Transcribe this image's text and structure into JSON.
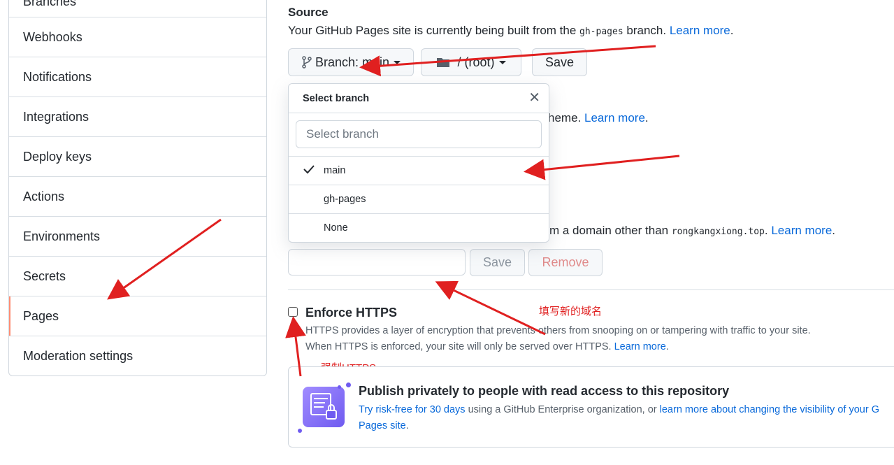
{
  "sidebar": {
    "items": [
      {
        "label": "Branches"
      },
      {
        "label": "Webhooks"
      },
      {
        "label": "Notifications"
      },
      {
        "label": "Integrations"
      },
      {
        "label": "Deploy keys"
      },
      {
        "label": "Actions"
      },
      {
        "label": "Environments"
      },
      {
        "label": "Secrets"
      },
      {
        "label": "Pages"
      },
      {
        "label": "Moderation settings"
      }
    ],
    "selected": "Pages"
  },
  "source": {
    "title": "Source",
    "desc_before": "Your GitHub Pages site is currently being built from the ",
    "branch_code": "gh-pages",
    "desc_after": " branch. ",
    "learn_more": "Learn more",
    "period": "."
  },
  "buttons": {
    "branch": "Branch: main",
    "folder": "/ (root)",
    "save": "Save"
  },
  "theme": {
    "text": "heme. ",
    "learn_more": "Learn more",
    "period": "."
  },
  "custom_domain": {
    "text_before": "m a domain other than ",
    "domain": "rongkangxiong.top",
    "text_after": ". ",
    "learn_more": "Learn more",
    "period": ".",
    "input_value": "",
    "save_label": "Save",
    "remove_label": "Remove"
  },
  "dropdown": {
    "title": "Select branch",
    "filter_placeholder": "Select branch",
    "items": [
      {
        "label": "main",
        "selected": true
      },
      {
        "label": "gh-pages",
        "selected": false
      },
      {
        "label": "None",
        "selected": false
      }
    ]
  },
  "https": {
    "title": "Enforce HTTPS",
    "checked": false,
    "line1": "HTTPS provides a layer of encryption that prevents others from snooping on or tampering with traffic to your site.",
    "line2": "When HTTPS is enforced, your site will only be served over HTTPS. ",
    "learn_more": "Learn more",
    "period": "."
  },
  "annotations": {
    "domain_note": "填写新的域名",
    "https_note": "强制HTTPS"
  },
  "promo": {
    "title": "Publish privately to people with read access to this repository",
    "link1": "Try risk-free for 30 days",
    "mid": " using a GitHub Enterprise organization, or ",
    "link2": "learn more about changing the visibility of your G",
    "link2_cont": "Pages site",
    "period": "."
  },
  "colors": {
    "accent_link": "#0969da",
    "annotation_red": "#e02020",
    "selected_marker": "#fd8c73",
    "promo_purple": "#6f5bf0"
  }
}
